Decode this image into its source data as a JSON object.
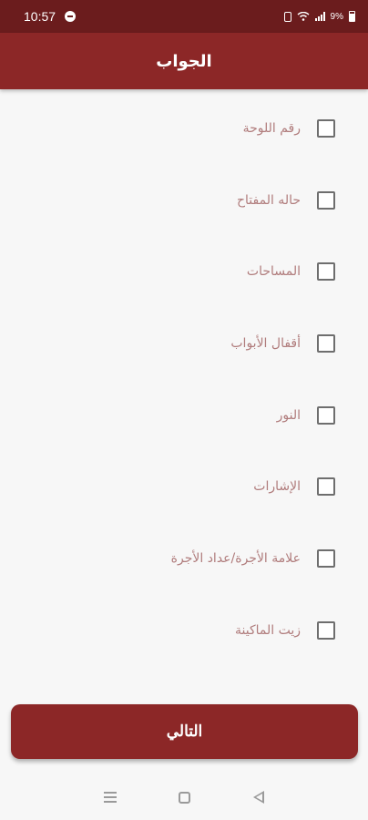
{
  "status_bar": {
    "time": "10:57",
    "battery": "9%"
  },
  "app_bar": {
    "title": "الجواب"
  },
  "options": [
    {
      "label": "رقم اللوحة",
      "checked": false
    },
    {
      "label": "حاله المفتاح",
      "checked": false
    },
    {
      "label": "المساحات",
      "checked": false
    },
    {
      "label": "أقفال الأبواب",
      "checked": false
    },
    {
      "label": "النور",
      "checked": false
    },
    {
      "label": "الإشارات",
      "checked": false
    },
    {
      "label": "علامة الأجرة/عداد الأجرة",
      "checked": false
    },
    {
      "label": "زيت الماكينة",
      "checked": false
    }
  ],
  "next_button": {
    "label": "التالي"
  },
  "colors": {
    "primary": "#8c2727",
    "status_bar": "#6b1c1d",
    "label_text": "#b07c7c"
  },
  "icons": {
    "status": [
      "messenger-icon",
      "vibrate-icon",
      "wifi-icon",
      "signal-icon",
      "battery-icon"
    ],
    "nav": [
      "recent-apps-icon",
      "home-icon",
      "back-icon"
    ]
  }
}
